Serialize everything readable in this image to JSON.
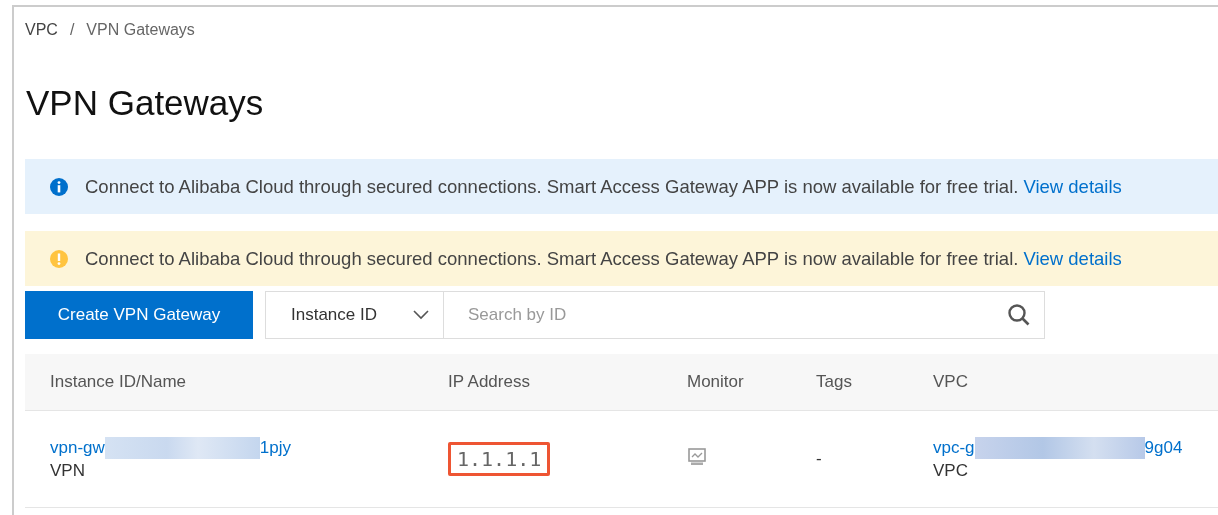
{
  "breadcrumb": [
    {
      "label": "VPC"
    },
    {
      "label": "VPN Gateways"
    }
  ],
  "breadcrumb_separator": "/",
  "title": "VPN Gateways",
  "notices": [
    {
      "kind": "info",
      "text": "Connect to Alibaba Cloud through secured connections. Smart Access Gateway APP is now available for free trial.",
      "link": "View details"
    },
    {
      "kind": "warning",
      "text": "Connect to Alibaba Cloud through secured connections. Smart Access Gateway APP is now available for free trial.",
      "link": "View details"
    }
  ],
  "toolbar": {
    "create_button": "Create VPN Gateway",
    "filter": {
      "value": "Instance ID"
    },
    "search": {
      "placeholder": "Search by ID"
    }
  },
  "table": {
    "columns": [
      "Instance ID/Name",
      "IP Address",
      "Monitor",
      "Tags",
      "VPC"
    ],
    "rows": [
      {
        "instance": {
          "id_prefix": "vpn-gw",
          "id_suffix": "1pjy",
          "redacted": true,
          "name": "VPN"
        },
        "ip_address": {
          "text": "1.1.1.1",
          "highlighted": true
        },
        "tags": "-",
        "vpc": {
          "id_prefix": "vpc-g",
          "id_suffix": "9g04",
          "redacted": true,
          "name": "VPC"
        }
      }
    ]
  }
}
